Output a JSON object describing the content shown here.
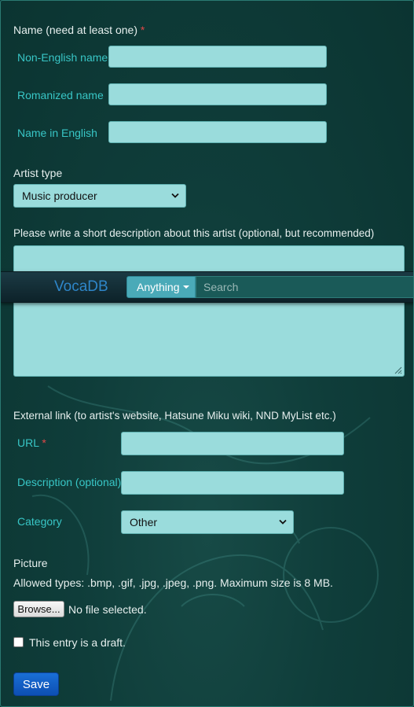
{
  "form": {
    "name_label": "Name (need at least one)",
    "required_mark": "*",
    "non_english_label": "Non-English name",
    "romanized_label": "Romanized name",
    "english_label": "Name in English",
    "artist_type_label": "Artist type",
    "artist_type_value": "Music producer",
    "description_label": "Please write a short description about this artist (optional, but recommended)",
    "external_link_label": "External link (to artist's website, Hatsune Miku wiki, NND MyList etc.)",
    "url_label": "URL",
    "link_description_label": "Description (optional)",
    "category_label": "Category",
    "category_value": "Other",
    "picture_label": "Picture",
    "allowed_types_text": "Allowed types: .bmp, .gif, .jpg, .jpeg, .png. Maximum size is 8 MB.",
    "browse_label": "Browse...",
    "no_file_text": "No file selected.",
    "draft_label": "This entry is a draft.",
    "save_label": "Save"
  },
  "navbar": {
    "brand": "VocaDB",
    "search_scope": "Anything",
    "search_placeholder": "Search"
  },
  "colors": {
    "background": "#0d3a38",
    "input": "#9adcdc",
    "sublabel": "#38c6c6",
    "required": "#e04848",
    "brand": "#2e86c9",
    "save_button": "#1a6fd6"
  }
}
